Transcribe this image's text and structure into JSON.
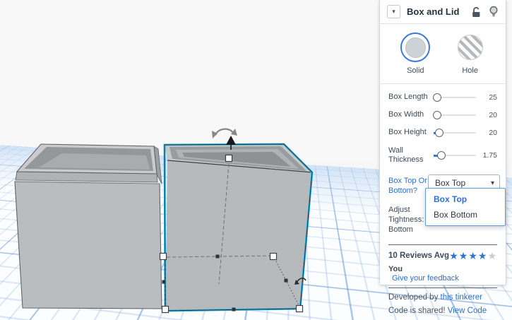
{
  "panel": {
    "title": "Box and Lid",
    "material": {
      "options": [
        {
          "label": "Solid",
          "selected": true
        },
        {
          "label": "Hole",
          "selected": false
        }
      ]
    },
    "sliders": [
      {
        "label": "Box Length",
        "value": "25"
      },
      {
        "label": "Box Width",
        "value": "20"
      },
      {
        "label": "Box Height",
        "value": "20"
      },
      {
        "label": "Wall Thickness",
        "value": "1.75"
      }
    ],
    "select": {
      "label": "Box Top Or Bottom?",
      "value": "Box Top",
      "open": true,
      "options": [
        "Box Top",
        "Box Bottom"
      ]
    },
    "tightness": {
      "label": "Adjust Tightness: Bottom"
    },
    "reviews": {
      "text": "10 Reviews Avg",
      "stars_filled": 4,
      "stars_total": 5
    },
    "feedback": {
      "you": "You",
      "link": "Give your feedback"
    },
    "developer": {
      "prefix": "Developed by",
      "link": "this tinkerer"
    },
    "share": {
      "prefix": "Code is shared!",
      "link": "View Code"
    },
    "colors": {
      "accent": "#2970d6",
      "star_empty": "#c7ccd1",
      "selection": "#2bb4e6"
    }
  },
  "scene": {
    "objects": [
      {
        "name": "box-bottom",
        "selected": false
      },
      {
        "name": "box-lid",
        "selected": true
      }
    ]
  }
}
